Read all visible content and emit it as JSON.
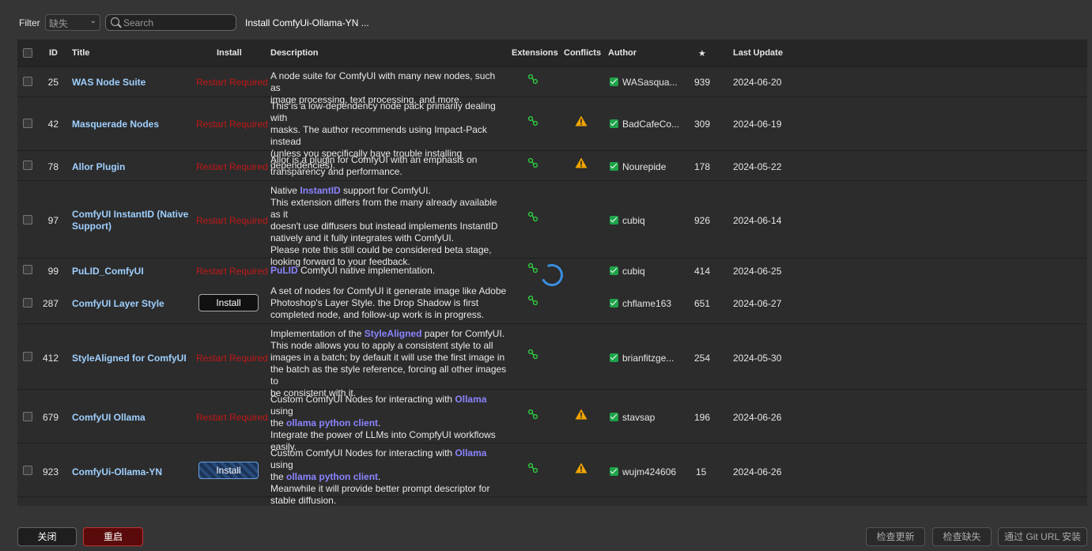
{
  "filter": {
    "label": "Filter",
    "selected": "缺失",
    "search_placeholder": "Search",
    "status": "Install ComfyUi-Ollama-YN ..."
  },
  "columns": {
    "id": "ID",
    "title": "Title",
    "install": "Install",
    "description": "Description",
    "extensions": "Extensions",
    "conflicts": "Conflicts",
    "author": "Author",
    "stars": "★",
    "last_update": "Last Update"
  },
  "rows": [
    {
      "id": "25",
      "title": "WAS Node Suite",
      "install": "Restart Required",
      "desc": [
        [
          "A node suite for ComfyUI with many new nodes, such as",
          ""
        ],
        [
          "image processing, text processing, and more.",
          ""
        ]
      ],
      "conflict": false,
      "author": "WASasqua...",
      "stars": "939",
      "date": "2024-06-20"
    },
    {
      "id": "42",
      "title": "Masquerade Nodes",
      "install": "Restart Required",
      "conflict": true,
      "author": "BadCafeCo...",
      "stars": "309",
      "date": "2024-06-19"
    },
    {
      "id": "78",
      "title": "Allor Plugin",
      "install": "Restart Required",
      "conflict": true,
      "author": "Nourepide",
      "stars": "178",
      "date": "2024-05-22"
    },
    {
      "id": "97",
      "title": "ComfyUI InstantID (Native Support)",
      "install": "Restart Required",
      "conflict": false,
      "author": "cubiq",
      "stars": "926",
      "date": "2024-06-14"
    },
    {
      "id": "99",
      "title": "PuLID_ComfyUI",
      "install": "Restart Required",
      "conflict": false,
      "author": "cubiq",
      "stars": "414",
      "date": "2024-06-25"
    },
    {
      "id": "287",
      "title": "ComfyUI Layer Style",
      "install": "Install",
      "conflict": false,
      "author": "chflame163",
      "stars": "651",
      "date": "2024-06-27"
    },
    {
      "id": "412",
      "title": "StyleAligned for ComfyUI",
      "install": "Restart Required",
      "conflict": false,
      "author": "brianfitzge...",
      "stars": "254",
      "date": "2024-05-30"
    },
    {
      "id": "679",
      "title": "ComfyUI Ollama",
      "install": "Restart Required",
      "conflict": true,
      "author": "stavsap",
      "stars": "196",
      "date": "2024-06-26"
    },
    {
      "id": "923",
      "title": "ComfyUi-Ollama-YN",
      "install": "Install",
      "conflict": true,
      "author": "wujm424606",
      "stars": "15",
      "date": "2024-06-26"
    }
  ],
  "descriptions": {
    "d25": [
      "A node suite for ComfyUI with many new nodes, such as",
      "image processing, text processing, and more."
    ],
    "d42": [
      "This is a low-dependency node pack primarily dealing with",
      "masks. The author recommends using Impact-Pack instead",
      "(unless you specifically have trouble installing",
      "dependencies)."
    ],
    "d78": [
      "Allor is a plugin for ComfyUI with an emphasis on",
      "transparency and performance."
    ],
    "d97_a": "Native ",
    "d97_link": "InstantID",
    "d97_b": " support for ComfyUI.",
    "d97_rest": [
      "This extension differs from the many already available as it",
      "doesn't use diffusers but instead implements InstantID",
      "natively and it fully integrates with ComfyUI.",
      "Please note this still could be considered beta stage,",
      "looking forward to your feedback."
    ],
    "d99_link": "PuLID",
    "d99_rest": " ComfyUI native implementation.",
    "d287": [
      "A set of nodes for ComfyUI it generate image like Adobe",
      "Photoshop's Layer Style. the Drop Shadow is first",
      "completed node, and follow-up work is in progress."
    ],
    "d412_a": "Implementation of the ",
    "d412_link": "StyleAligned",
    "d412_b": " paper for ComfyUI.",
    "d412_rest": [
      "This node allows you to apply a consistent style to all",
      "images in a batch; by default it will use the first image in",
      "the batch as the style reference, forcing all other images to",
      "be consistent with it."
    ],
    "d679_a": "Custom ComfyUI Nodes for interacting with ",
    "d679_link1": "Ollama",
    "d679_b": " using",
    "d679_c": "the ",
    "d679_link2": "ollama python client",
    "d679_d": ".",
    "d679_rest": [
      "Integrate the power of LLMs into CompfyUI workflows",
      "easily."
    ],
    "d923_a": "Custom ComfyUI Nodes for interacting with ",
    "d923_link1": "Ollama",
    "d923_b": " using",
    "d923_c": "the ",
    "d923_link2": "ollama python client",
    "d923_d": ".",
    "d923_rest": [
      "Meanwhile it will provide better prompt descriptor for",
      "stable diffusion."
    ]
  },
  "buttons": {
    "close": "关闭",
    "restart": "重启",
    "check_update": "检查更新",
    "check_missing": "检查缺失",
    "install_via_git": "通过 Git URL 安装"
  },
  "colors": {
    "title": "#9fd0ff",
    "restart_required": "#c01818",
    "link": "#8a84ff",
    "ext_green": "#2ecc40",
    "warn": "#f0a500"
  }
}
